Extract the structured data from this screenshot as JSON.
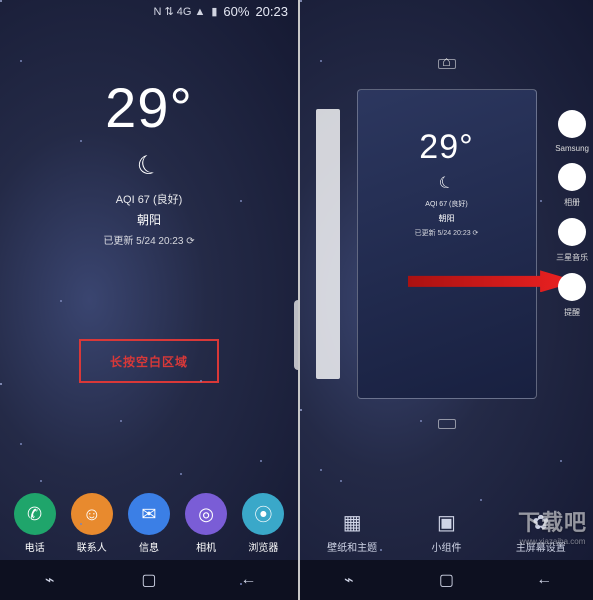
{
  "status": {
    "indicators": "N ⇅ 4G ▲",
    "battery": "60%",
    "time": "20:23"
  },
  "weather": {
    "temp": "29",
    "deg": "°",
    "aqi": "AQI 67 (良好)",
    "location": "朝阳",
    "updated": "已更新 5/24 20:23 ⟳"
  },
  "highlight_label": "长按空白区域",
  "dock": [
    {
      "label": "电话",
      "icon": "✆",
      "color": "c-green"
    },
    {
      "label": "联系人",
      "icon": "☺",
      "color": "c-orange"
    },
    {
      "label": "信息",
      "icon": "✉",
      "color": "c-blue"
    },
    {
      "label": "相机",
      "icon": "◎",
      "color": "c-purple"
    },
    {
      "label": "浏览器",
      "icon": "⦿",
      "color": "c-teal"
    }
  ],
  "nav": {
    "recent": "⌁",
    "home": "▢",
    "back": "←"
  },
  "overview": {
    "home_icon": "⌂",
    "options": [
      {
        "label": "壁纸和主题",
        "icon": "▦"
      },
      {
        "label": "小组件",
        "icon": "▣"
      },
      {
        "label": "主屏幕设置",
        "icon": "✿"
      }
    ]
  },
  "edge_apps": [
    {
      "label": "Samsung",
      "cls": "e1"
    },
    {
      "label": "相册",
      "cls": "e2"
    },
    {
      "label": "三星音乐",
      "cls": "e3"
    },
    {
      "label": "提醒",
      "cls": "e4"
    }
  ],
  "watermark": {
    "big": "下载吧",
    "small": "www.xiazaiba.com"
  }
}
